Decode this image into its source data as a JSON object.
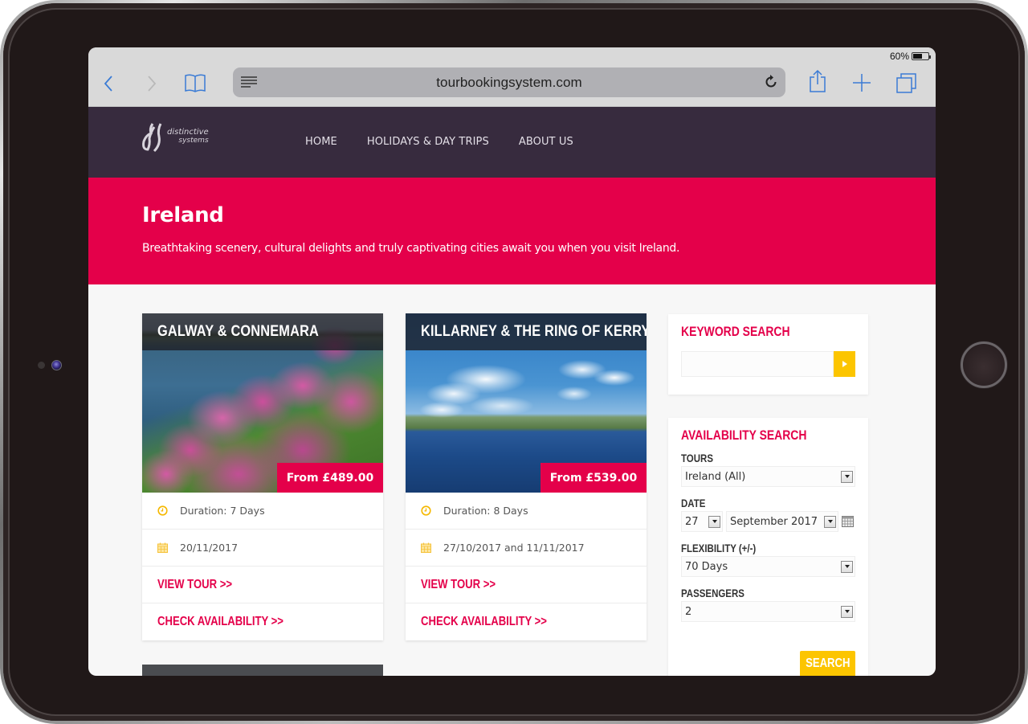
{
  "device": {
    "status_bar": {
      "battery_percent_label": "60%",
      "battery_level": 0.6
    }
  },
  "browser": {
    "url": "tourbookingsystem.com",
    "icons": {
      "back": "chevron-left-icon",
      "forward": "chevron-right-icon",
      "bookmarks": "open-book-icon",
      "reader": "reader-lines-icon",
      "reload": "reload-icon",
      "share": "share-icon",
      "new_tab": "plus-icon",
      "tabs": "tabs-icon"
    }
  },
  "site": {
    "logo": {
      "line1": "distinctive",
      "line2": "systems"
    },
    "nav": [
      {
        "label": "HOME"
      },
      {
        "label": "HOLIDAYS & DAY TRIPS"
      },
      {
        "label": "ABOUT US"
      }
    ],
    "colors": {
      "header": "#372b3e",
      "accent": "#e4004a",
      "button": "#fcc500"
    }
  },
  "hero": {
    "title": "Ireland",
    "subtitle": "Breathtaking scenery, cultural delights and truly captivating cities await you when you visit Ireland."
  },
  "tours": [
    {
      "title": "GALWAY & CONNEMARA",
      "price": "From £489.00",
      "duration": "Duration: 7 Days",
      "dates": "20/11/2017",
      "view_label": "VIEW TOUR >>",
      "check_label": "CHECK AVAILABILITY >>"
    },
    {
      "title": "KILLARNEY & THE RING OF KERRY",
      "price": "From £539.00",
      "duration": "Duration: 8 Days",
      "dates": "27/10/2017 and 11/11/2017",
      "view_label": "VIEW TOUR >>",
      "check_label": "CHECK AVAILABILITY >>"
    }
  ],
  "sidebar": {
    "keyword": {
      "title": "KEYWORD SEARCH",
      "value": "",
      "placeholder": ""
    },
    "availability": {
      "title": "AVAILABILITY SEARCH",
      "tours_label": "TOURS",
      "tours_value": "Ireland (All)",
      "date_label": "DATE",
      "day_value": "27",
      "month_value": "September 2017",
      "flex_label": "FLEXIBILITY (+/-)",
      "flex_value": "70 Days",
      "passengers_label": "PASSENGERS",
      "passengers_value": "2",
      "search_label": "SEARCH"
    }
  }
}
